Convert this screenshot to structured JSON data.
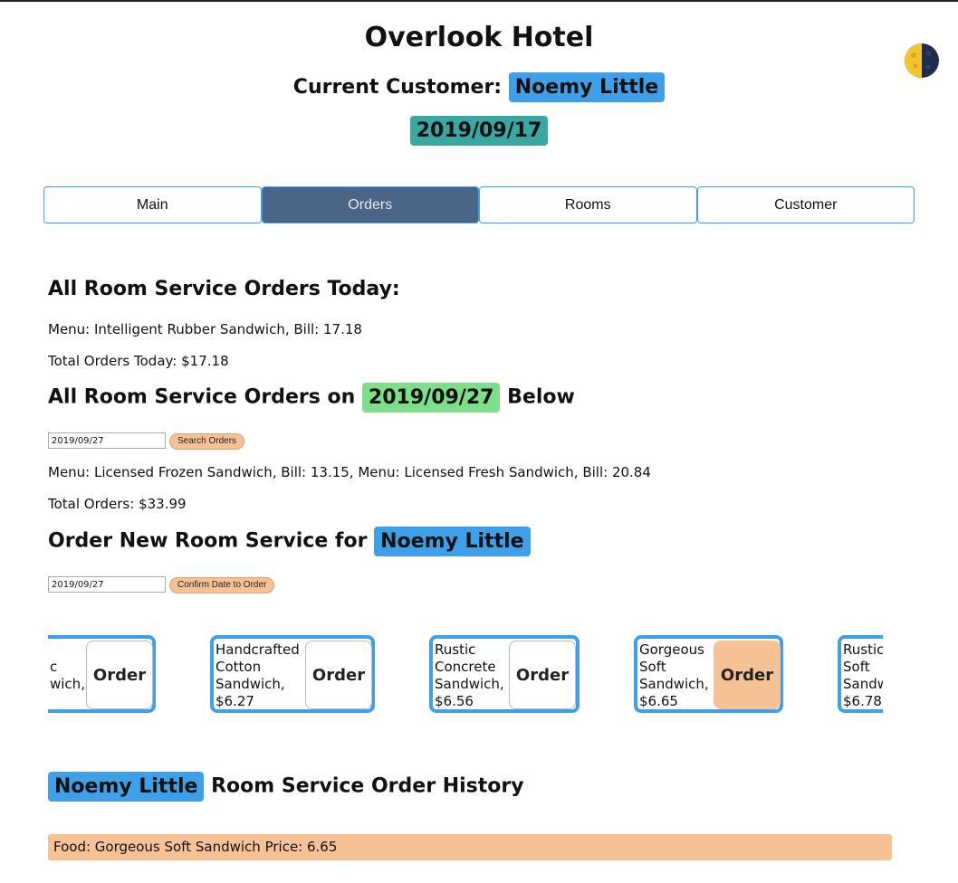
{
  "header": {
    "title": "Overlook Hotel",
    "customer_label": "Current Customer:",
    "customer_name": "Noemy Little",
    "date": "2019/09/17",
    "theme_icon": "moon-icon"
  },
  "tabs": [
    {
      "label": "Main",
      "active": false
    },
    {
      "label": "Orders",
      "active": true
    },
    {
      "label": "Rooms",
      "active": false
    },
    {
      "label": "Customer",
      "active": false
    }
  ],
  "today": {
    "heading": "All Room Service Orders Today:",
    "menu": "Menu: Intelligent Rubber Sandwich, Bill: 17.18",
    "total": "Total Orders Today: $17.18"
  },
  "search": {
    "heading_pre": "All Room Service Orders on",
    "heading_date": "2019/09/27",
    "heading_post": "Below",
    "input_value": "2019/09/27",
    "button": "Search Orders",
    "menu": "Menu: Licensed Frozen Sandwich, Bill: 13.15, Menu: Licensed Fresh Sandwich, Bill: 20.84",
    "total": "Total Orders: $33.99"
  },
  "new_order": {
    "heading_pre": "Order New Room Service for",
    "customer_name": "Noemy Little",
    "input_value": "2019/09/27",
    "button": "Confirm Date to Order"
  },
  "menu_cards": [
    {
      "lines": [
        "",
        "c",
        "wich,",
        ""
      ],
      "order": "Order",
      "highlighted": false
    },
    {
      "lines": [
        "Handcrafted",
        "Cotton",
        "Sandwich,",
        "$6.27"
      ],
      "order": "Order",
      "highlighted": false
    },
    {
      "lines": [
        "Rustic",
        "Concrete",
        "Sandwich,",
        "$6.56"
      ],
      "order": "Order",
      "highlighted": false
    },
    {
      "lines": [
        "Gorgeous",
        "Soft",
        "Sandwich,",
        "$6.65"
      ],
      "order": "Order",
      "highlighted": true
    },
    {
      "lines": [
        "Rustic",
        "Soft",
        "Sandw",
        "$6.78"
      ],
      "order": "",
      "highlighted": false
    }
  ],
  "history": {
    "customer_name": "Noemy Little",
    "heading_post": "Room Service Order History",
    "rows": [
      "Food: Gorgeous Soft Sandwich Price: 6.65"
    ]
  },
  "colors": {
    "accent_blue": "#3fa0ea",
    "tab_active": "#4a6585",
    "date_teal": "#3aa8a0",
    "date_green": "#7fde8a",
    "peach": "#f7c196"
  }
}
